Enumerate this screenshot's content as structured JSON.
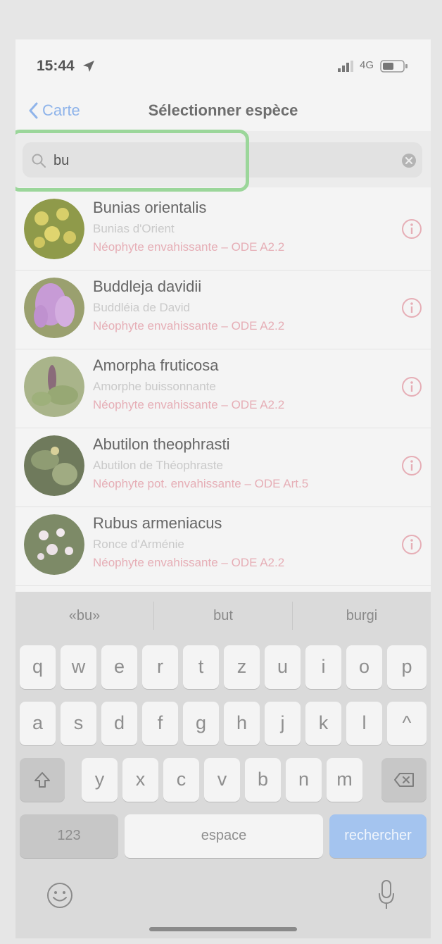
{
  "status_bar": {
    "time": "15:44",
    "network": "4G"
  },
  "nav": {
    "back_label": "Carte",
    "title": "Sélectionner espèce"
  },
  "search": {
    "value": "bu",
    "placeholder": ""
  },
  "results": [
    {
      "latin": "Bunias orientalis",
      "common": "Bunias d'Orient",
      "status": "Néophyte envahissante – ODE A2.2"
    },
    {
      "latin": "Buddleja davidii",
      "common": "Buddléia de David",
      "status": "Néophyte envahissante – ODE A2.2"
    },
    {
      "latin": "Amorpha fruticosa",
      "common": "Amorphe buissonnante",
      "status": "Néophyte envahissante – ODE A2.2"
    },
    {
      "latin": "Abutilon theophrasti",
      "common": "Abutilon de Théophraste",
      "status": "Néophyte pot. envahissante – ODE Art.5"
    },
    {
      "latin": "Rubus armeniacus",
      "common": "Ronce d'Arménie",
      "status": "Néophyte envahissante – ODE A2.2"
    }
  ],
  "keyboard": {
    "suggestions": [
      "«bu»",
      "but",
      "burgi"
    ],
    "row1": [
      "q",
      "w",
      "e",
      "r",
      "t",
      "z",
      "u",
      "i",
      "o",
      "p"
    ],
    "row2": [
      "a",
      "s",
      "d",
      "f",
      "g",
      "h",
      "j",
      "k",
      "l",
      "^"
    ],
    "row3": [
      "y",
      "x",
      "c",
      "v",
      "b",
      "n",
      "m"
    ],
    "numbers_label": "123",
    "space_label": "espace",
    "search_label": "rechercher"
  },
  "colors": {
    "accent": "#8fb4ea",
    "highlight": "#9bd69a",
    "status_text": "#e6aeb6"
  },
  "icons": [
    "location-arrow-icon",
    "signal-icon",
    "battery-icon",
    "chevron-left-icon",
    "search-icon",
    "clear-icon",
    "info-icon",
    "shift-icon",
    "backspace-icon",
    "emoji-icon",
    "microphone-icon"
  ]
}
